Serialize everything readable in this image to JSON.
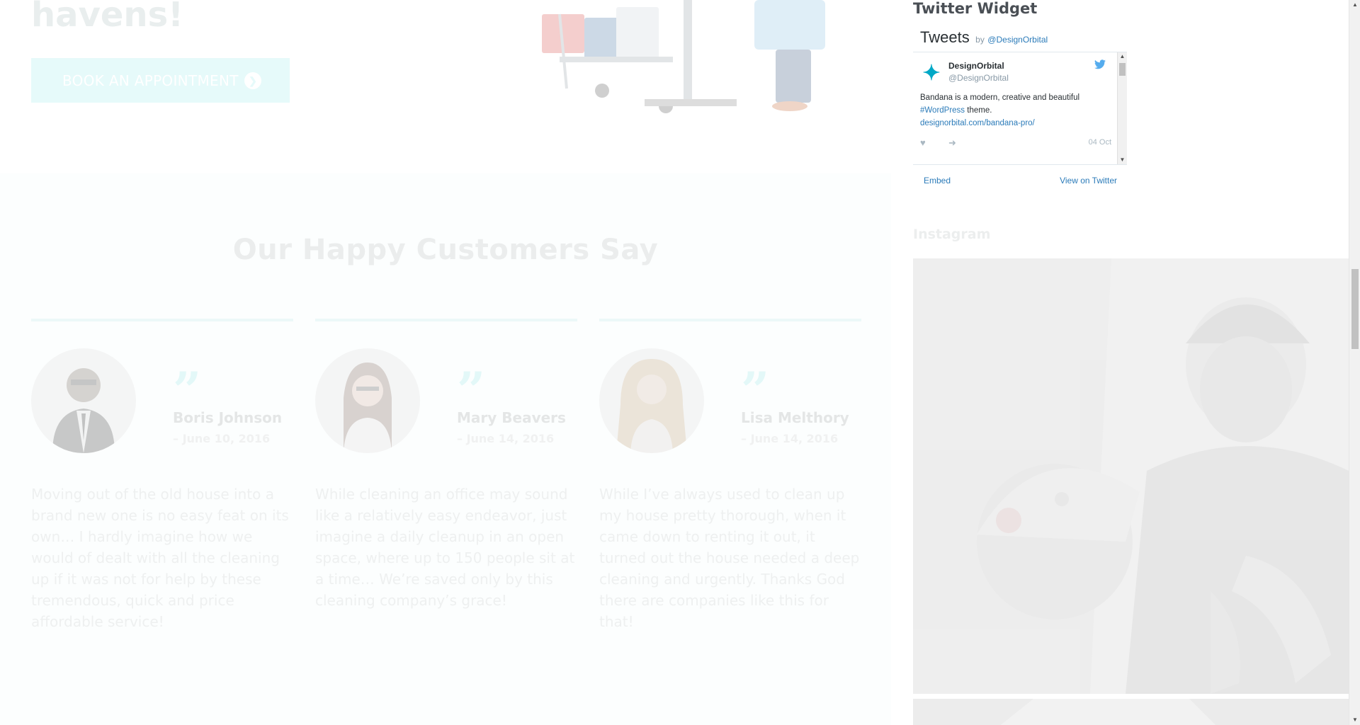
{
  "hero": {
    "title_fragment": "havens!",
    "book_button_label": "BOOK AN APPOINTMENT"
  },
  "testimonials": {
    "heading": "Our Happy Customers Say",
    "items": [
      {
        "name": "Boris Johnson",
        "date": "– June 10, 2016",
        "text": "Moving out of the old house into a brand new one is no easy feat on its own… I hardly imagine how we would of dealt with all the cleaning up if it was not for help by these tremendous, quick and price affordable service!"
      },
      {
        "name": "Mary Beavers",
        "date": "– June 14, 2016",
        "text": "While cleaning an office may sound like a relatively easy endeavor, just imagine a daily cleanup in an open space, where up to 150 people sit at a time… We’re saved only by this cleaning company’s grace!"
      },
      {
        "name": "Lisa Melthory",
        "date": "– June 14, 2016",
        "text": "While I’ve always used to clean up my house pretty thorough, when it came down to renting it out, it turned out the house needed a deep cleaning and urgently. Thanks God there are companies like this for that!"
      }
    ]
  },
  "sidebar": {
    "twitter": {
      "widget_title": "Twitter Widget",
      "tweets_label": "Tweets",
      "by_label": "by",
      "by_handle": "@DesignOrbital",
      "tweet": {
        "author": "DesignOrbital",
        "handle": "@DesignOrbital",
        "text_1": "Bandana is a modern, creative and beautiful",
        "hashtag": "#WordPress",
        "text_2": "theme.",
        "link": "designorbital.com/bandana-pro/",
        "date": "04 Oct"
      },
      "embed_label": "Embed",
      "view_label": "View on Twitter"
    },
    "instagram": {
      "title": "Instagram"
    }
  },
  "colors": {
    "accent_faded": "#e6fafa",
    "twitter_link": "#2b7bb9",
    "twitter_bird": "#55acee"
  },
  "icons": {
    "book_arrow": "arrow-circle-right-icon",
    "tweet_author_logo": "designorbital-logo-icon",
    "bird": "twitter-bird-icon",
    "like": "heart-icon",
    "share": "share-icon"
  }
}
